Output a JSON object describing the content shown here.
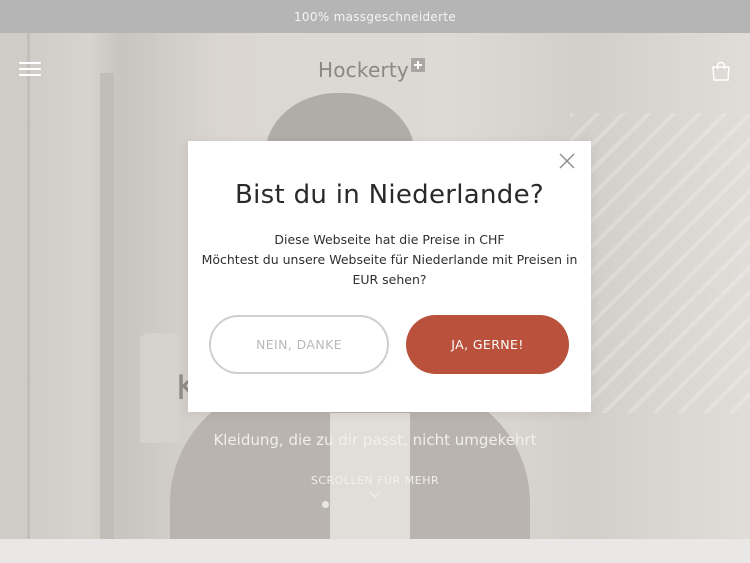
{
  "announcement": {
    "text": "100% massgeschneiderte"
  },
  "header": {
    "logo_text": "Hockerty",
    "menu_icon": "hamburger-menu-icon",
    "cart_icon": "shopping-bag-icon"
  },
  "hero": {
    "heading_fragment": "K",
    "subtitle": "Kleidung, die zu dir passt, nicht umgekehrt",
    "scroll_hint": "SCROLLEN FÜR MEHR"
  },
  "modal": {
    "title": "Bist du in Niederlande?",
    "line1": "Diese Webseite hat die Preise in CHF",
    "line2": "Möchtest du unsere Webseite für Niederlande mit Preisen in",
    "line3": "EUR sehen?",
    "decline_label": "NEIN, DANKE",
    "accept_label": "JA, GERNE!",
    "close_icon": "close-icon"
  },
  "colors": {
    "accent": "#b9513c",
    "announcement_bg": "#b5b5b5",
    "modal_bg": "#ffffff",
    "title_text": "#2a2a2a"
  }
}
